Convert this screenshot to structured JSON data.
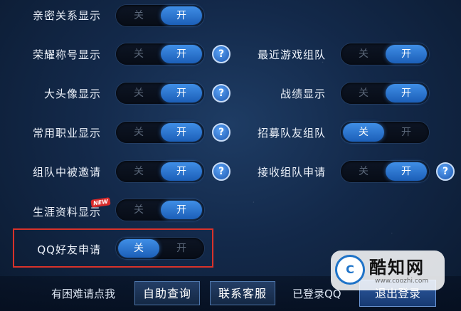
{
  "toggle_labels": {
    "off": "关",
    "on": "开"
  },
  "left_settings": [
    {
      "label": "亲密关系显示",
      "state": "on",
      "help": false
    },
    {
      "label": "荣耀称号显示",
      "state": "on",
      "help": true
    },
    {
      "label": "大头像显示",
      "state": "on",
      "help": true
    },
    {
      "label": "常用职业显示",
      "state": "on",
      "help": true
    },
    {
      "label": "组队中被邀请",
      "state": "on",
      "help": true
    },
    {
      "label": "生涯资料显示",
      "state": "on",
      "help": false,
      "badge": "NEW"
    },
    {
      "label": "QQ好友申请",
      "state": "off",
      "help": false
    }
  ],
  "right_settings": [
    {
      "label": "最近游戏组队",
      "state": "on",
      "help": false
    },
    {
      "label": "战绩显示",
      "state": "on",
      "help": false
    },
    {
      "label": "招募队友组队",
      "state": "off",
      "help": false
    },
    {
      "label": "接收组队申请",
      "state": "on",
      "help": true
    }
  ],
  "help_glyph": "?",
  "bottom": {
    "hint": "有困难请点我",
    "self_service": "自助查询",
    "contact": "联系客服",
    "logged_in": "已登录QQ",
    "logout": "退出登录"
  },
  "watermark": {
    "logo": "C",
    "name": "酷知网",
    "url": "www.coozhi.com"
  },
  "colors": {
    "toggle_on": "#2f7fe0",
    "highlight": "#d8322a",
    "badge": "#d82a2a"
  }
}
